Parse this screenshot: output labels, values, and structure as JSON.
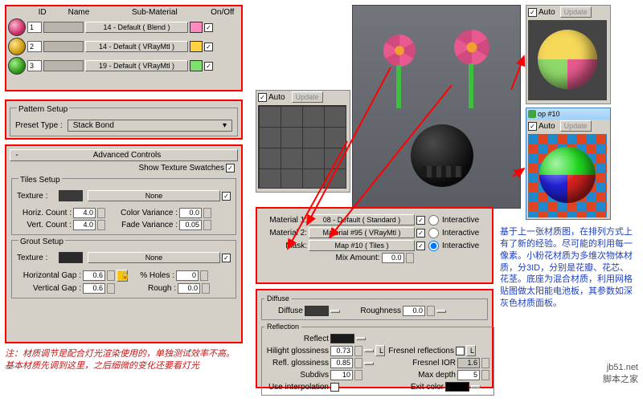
{
  "sublist": {
    "cols": [
      "ID",
      "Name",
      "Sub-Material",
      "On/Off"
    ],
    "rows": [
      {
        "id": "1",
        "name": "",
        "sub": "14 - Default  ( Blend )",
        "color": "#ff8abf",
        "sw": "radial-gradient(circle at 35% 35%, #ffb3d1, #cc2f67 60%, #7a1b3d)"
      },
      {
        "id": "2",
        "name": "",
        "sub": "14 - Default  ( VRayMtl )",
        "color": "#ffd23f",
        "sw": "radial-gradient(circle at 35% 35%, #ffe38a, #cc9a10 60%, #6b4f05)"
      },
      {
        "id": "3",
        "name": "",
        "sub": "19 - Default  ( VRayMtl )",
        "color": "#7fe06b",
        "sw": "radial-gradient(circle at 35% 35%, #9ff088, #2f9a18 60%, #1b5a0e)"
      }
    ]
  },
  "pattern": {
    "title": "Pattern Setup",
    "label": "Preset Type :",
    "value": "Stack Bond"
  },
  "adv": {
    "title": "Advanced Controls",
    "swatch": "Show Texture Swatches",
    "tiles": {
      "title": "Tiles Setup",
      "tex": "Texture :",
      "texv": "None",
      "hc": "Horiz. Count :",
      "hcv": "4.0",
      "vc": "Vert. Count :",
      "vcv": "4.0",
      "cv": "Color Variance :",
      "cvv": "0.0",
      "fv": "Fade Variance :",
      "fvv": "0.05"
    },
    "grout": {
      "title": "Grout Setup",
      "tex": "Texture :",
      "texv": "None",
      "hg": "Horizontal Gap :",
      "hgv": "0.6",
      "vg": "Vertical Gap :",
      "vgv": "0.6",
      "ph": "% Holes :",
      "phv": "0",
      "r": "Rough :",
      "rv": "0.0"
    }
  },
  "auto": {
    "auto": "Auto",
    "update": "Update"
  },
  "blend": {
    "m1": "Material 1:",
    "m1v": "08 - Default  ( Standard )",
    "m2": "Material 2:",
    "m2v": "Material #95  ( VRayMtl )",
    "mask": "Mask:",
    "maskv": "Map #10  ( Tiles )",
    "mix": "Mix Amount:",
    "mixv": "0.0",
    "inter": "Interactive"
  },
  "vray": {
    "d": {
      "t": "Diffuse",
      "dl": "Diffuse",
      "rl": "Roughness",
      "rv": "0.0"
    },
    "r": {
      "t": "Reflection",
      "rl": "Reflect",
      "hg": "Hilight glossiness",
      "hgv": "0.73",
      "rg": "Refl. glossiness",
      "rgv": "0.85",
      "sub": "Subdivs",
      "subv": "10",
      "ui": "Use interpolation",
      "fr": "Fresnel reflections",
      "fi": "Fresnel IOR",
      "fiv": "1.6",
      "md": "Max depth",
      "mdv": "5",
      "ec": "Exit color",
      "L": "L"
    }
  },
  "preview": {
    "title": "op  #10",
    "auto": "Auto",
    "update": "Update"
  },
  "note": "注：材质调节是配合灯光渲染使用的，单独测试效率不高。基本材质先调到这里，之后细微的变化还要看灯光",
  "caption": "基于上一张材质图，在排列方式上有了新的经验。尽可能的利用每一像素。小粉花材质为多维次物体材质，分3ID，分别是花瓣、花芯、花茎。底座为混合材质，利用网格贴图做太阳能电池板，其参数如深灰色材质面板。",
  "watermark": "jb51.net\n脚本之家"
}
